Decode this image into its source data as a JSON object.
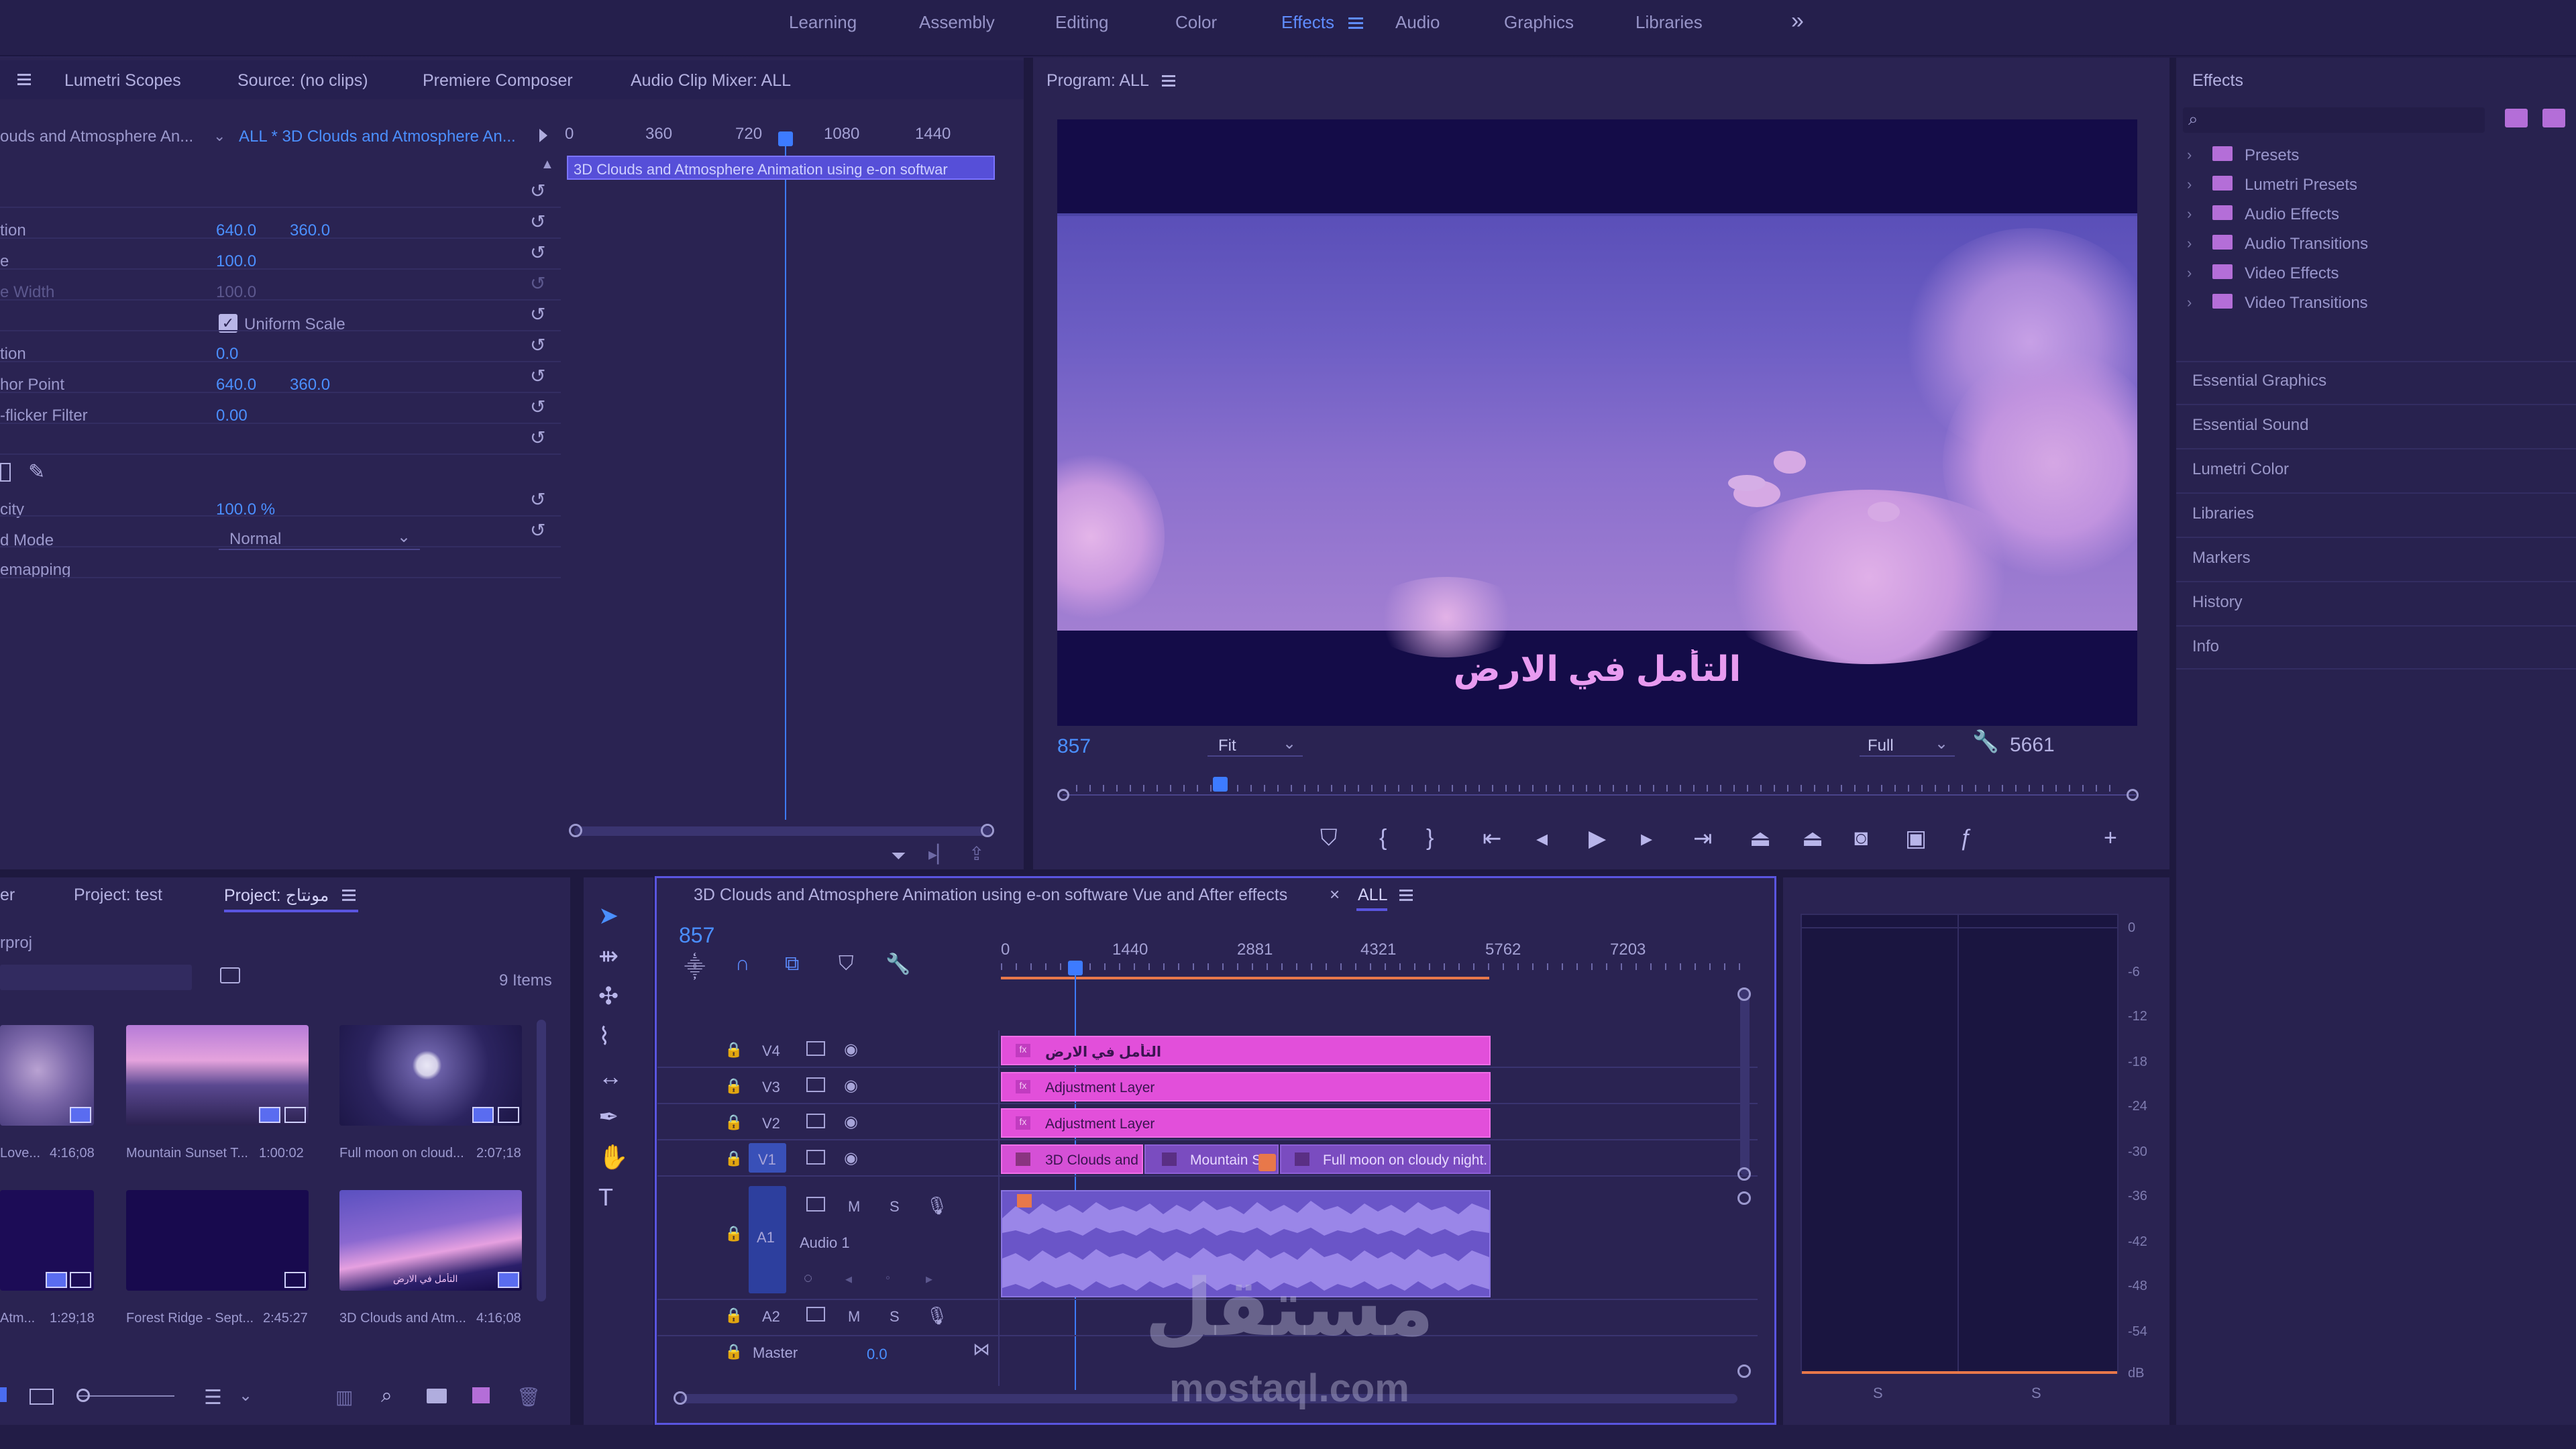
{
  "workspaces": {
    "items": [
      "Learning",
      "Assembly",
      "Editing",
      "Color",
      "Effects",
      "Audio",
      "Graphics",
      "Libraries"
    ],
    "active": "Effects",
    "more": "»"
  },
  "effect_controls": {
    "tabs": [
      "Lumetri Scopes",
      "Source: (no clips)",
      "Premiere Composer",
      "Audio Clip Mixer: ALL"
    ],
    "clip_selector": "ouds and Atmosphere An...",
    "sequence_selector": "ALL * 3D Clouds and Atmosphere An...",
    "ruler": [
      "0",
      "360",
      "720",
      "1080",
      "1440"
    ],
    "clip_bar": "3D Clouds and Atmosphere Animation using e-on softwar",
    "rows": [
      {
        "label": "tion",
        "v1": "640.0",
        "v2": "360.0"
      },
      {
        "label": "e",
        "v1": "100.0",
        "v2": ""
      },
      {
        "label": "e Width",
        "v1": "100.0",
        "v2": ""
      },
      {
        "label": "",
        "v1": "Uniform Scale",
        "v2": ""
      },
      {
        "label": "tion",
        "v1": "0.0",
        "v2": ""
      },
      {
        "label": "hor Point",
        "v1": "640.0",
        "v2": "360.0"
      },
      {
        "label": "-flicker Filter",
        "v1": "0.00",
        "v2": ""
      },
      {
        "label": "",
        "v1": "",
        "v2": ""
      },
      {
        "label": "",
        "v1": "",
        "v2": ""
      },
      {
        "label": "city",
        "v1": "100.0 %",
        "v2": ""
      },
      {
        "label": "d Mode",
        "v1": "Normal",
        "v2": ""
      },
      {
        "label": "emapping",
        "v1": "",
        "v2": ""
      }
    ]
  },
  "program": {
    "title": "Program: ALL",
    "caption": "التأمل في الارض",
    "timecode": "857",
    "fit": "Fit",
    "quality": "Full",
    "duration": "5661",
    "playhead": 0.146
  },
  "effects_panel": {
    "title": "Effects",
    "search_placeholder": "",
    "items": [
      "Presets",
      "Lumetri Presets",
      "Audio Effects",
      "Audio Transitions",
      "Video Effects",
      "Video Transitions"
    ],
    "sections": [
      "Essential Graphics",
      "Essential Sound",
      "Lumetri Color",
      "Libraries",
      "Markers",
      "History",
      "Info"
    ]
  },
  "project": {
    "tabs": [
      "er",
      "Project: test",
      "Project: مونتاج"
    ],
    "path": "rproj",
    "count": "9 Items",
    "thumbs": [
      {
        "name": "Love...",
        "dur": "4:16;08"
      },
      {
        "name": "Mountain Sunset T...",
        "dur": "1:00:02"
      },
      {
        "name": "Full moon on cloud...",
        "dur": "2:07;18"
      },
      {
        "name": "Atm...",
        "dur": "1:29;18"
      },
      {
        "name": "Forest Ridge - Sept...",
        "dur": "2:45:27"
      },
      {
        "name": "3D Clouds and Atm...",
        "dur": "4:16;08"
      }
    ],
    "thumb_caption": "التأمل في الارض"
  },
  "timeline": {
    "tab1": "3D Clouds and Atmosphere Animation using e-on software Vue and After effects",
    "tab2": "ALL",
    "close": "×",
    "timecode": "857",
    "ruler": [
      "0",
      "1440",
      "2881",
      "4321",
      "5762",
      "7203"
    ],
    "tracks": [
      "V4",
      "V3",
      "V2",
      "V1",
      "A1",
      "A2"
    ],
    "audio_name": "Audio 1",
    "master": "Master",
    "master_val": "0.0",
    "mute": "M",
    "solo": "S",
    "clips": {
      "v4": "التأمل في الارض",
      "v3": "Adjustment Layer",
      "v2": "Adjustment Layer",
      "v1a": "3D Clouds and",
      "v1b": "Mountain S",
      "v1c": "Full moon on cloudy night."
    }
  },
  "meters": {
    "scale": [
      "0",
      "-6",
      "-12",
      "-18",
      "-24",
      "-30",
      "-36",
      "-42",
      "-48",
      "-54",
      "dB"
    ],
    "solo_labels": [
      "S",
      "S"
    ]
  },
  "watermark": {
    "arabic": "مستقل",
    "url": "mostaql.com"
  }
}
